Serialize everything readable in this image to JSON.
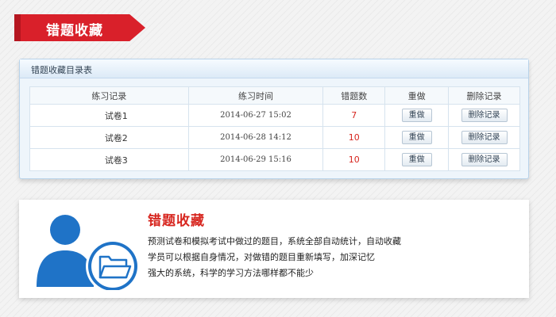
{
  "banner": {
    "title": "错题收藏",
    "color": "#d9202a"
  },
  "panel": {
    "title": "错题收藏目录表",
    "headers": {
      "record": "练习记录",
      "time": "练习时间",
      "count": "错题数",
      "redo": "重做",
      "delete": "删除记录"
    },
    "rows": [
      {
        "name": "试卷1",
        "time": "2014-06-27  15:02",
        "count": "7",
        "redo": "重做",
        "delete": "删除记录"
      },
      {
        "name": "试卷2",
        "time": "2014-06-28  14:12",
        "count": "10",
        "redo": "重做",
        "delete": "删除记录"
      },
      {
        "name": "试卷3",
        "time": "2014-06-29  15:16",
        "count": "10",
        "redo": "重做",
        "delete": "删除记录"
      }
    ]
  },
  "card": {
    "title": "错题收藏",
    "lines": [
      "预测试卷和模拟考试中做过的题目，系统全部自动统计，自动收藏",
      "学员可以根据自身情况，对做错的题目重新填写，加深记忆",
      "强大的系统，科学的学习方法哪样都不能少"
    ],
    "icons": [
      "user-icon",
      "folder-icon"
    ],
    "accent_color": "#d7261f",
    "icon_color": "#1f73c7"
  }
}
